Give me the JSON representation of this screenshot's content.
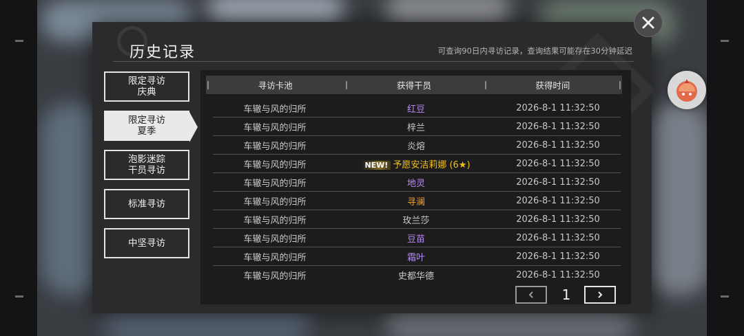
{
  "dialog": {
    "title": "历史记录",
    "notice": "可查询90日内寻访记录，查询结果可能存在30分钟延迟"
  },
  "icons": {
    "close": "close-icon",
    "avatar": "dollkeeper-avatar-icon",
    "prev": "chevron-left-icon",
    "next": "chevron-right-icon"
  },
  "sidebar": {
    "items": [
      {
        "label_line1": "限定寻访",
        "label_line2": "庆典",
        "active": false
      },
      {
        "label_line1": "限定寻访",
        "label_line2": "夏季",
        "active": true
      },
      {
        "label_line1": "泡影迷踪",
        "label_line2": "干员寻访",
        "active": false
      },
      {
        "label_line1": "标准寻访",
        "label_line2": "",
        "active": false
      },
      {
        "label_line1": "中坚寻访",
        "label_line2": "",
        "active": false
      }
    ]
  },
  "table": {
    "headers": [
      "寻访卡池",
      "获得干员",
      "获得时间"
    ],
    "rows": [
      {
        "pool": "车辙与风的归所",
        "operator": "红豆",
        "time": "2026-8-1 11:32:50",
        "color": "#b58cf0",
        "new": ""
      },
      {
        "pool": "车辙与风的归所",
        "operator": "梓兰",
        "time": "2026-8-1 11:32:50",
        "color": "#c8c8c8",
        "new": ""
      },
      {
        "pool": "车辙与风的归所",
        "operator": "炎熔",
        "time": "2026-8-1 11:32:50",
        "color": "#c8c8c8",
        "new": ""
      },
      {
        "pool": "车辙与风的归所",
        "operator": "予愿安洁莉娜 (6★)",
        "time": "2026-8-1 11:32:50",
        "color": "#f0c020",
        "new": "NEW!"
      },
      {
        "pool": "车辙与风的归所",
        "operator": "地灵",
        "time": "2026-8-1 11:32:50",
        "color": "#b58cf0",
        "new": ""
      },
      {
        "pool": "车辙与风的归所",
        "operator": "寻澜",
        "time": "2026-8-1 11:32:50",
        "color": "#f0a030",
        "new": ""
      },
      {
        "pool": "车辙与风的归所",
        "operator": "玫兰莎",
        "time": "2026-8-1 11:32:50",
        "color": "#c8c8c8",
        "new": ""
      },
      {
        "pool": "车辙与风的归所",
        "operator": "豆苗",
        "time": "2026-8-1 11:32:50",
        "color": "#b58cf0",
        "new": ""
      },
      {
        "pool": "车辙与风的归所",
        "operator": "霜叶",
        "time": "2026-8-1 11:32:50",
        "color": "#b58cf0",
        "new": ""
      },
      {
        "pool": "车辙与风的归所",
        "operator": "史都华德",
        "time": "2026-8-1 11:32:50",
        "color": "#c8c8c8",
        "new": ""
      }
    ]
  },
  "pagination": {
    "current_page": "1"
  }
}
